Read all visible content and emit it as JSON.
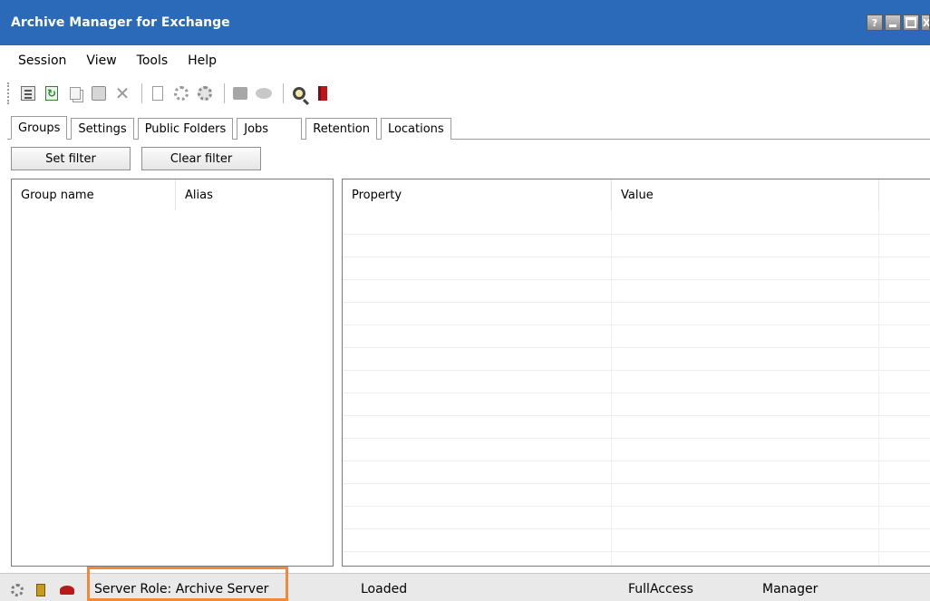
{
  "window": {
    "title": "Archive Manager for Exchange",
    "controls": {
      "help": "?",
      "close": "X"
    }
  },
  "menu": [
    "Session",
    "View",
    "Tools",
    "Help"
  ],
  "toolbar": {
    "icons": [
      "properties-icon",
      "refresh-icon",
      "copy-icon",
      "paste-icon",
      "delete-icon",
      "new-document-icon",
      "gear-icon",
      "gear-settings-icon",
      "note-icon",
      "comment-icon",
      "search-icon",
      "book-icon"
    ]
  },
  "tabs": [
    "Groups",
    "Settings",
    "Public Folders",
    "Jobs",
    "Retention",
    "Locations"
  ],
  "active_tab": "Groups",
  "filter": {
    "set_label": "Set filter",
    "clear_label": "Clear filter"
  },
  "groups_table": {
    "columns": [
      "Group name",
      "Alias"
    ],
    "rows": []
  },
  "properties_table": {
    "columns": [
      "Property",
      "Value"
    ],
    "rows": []
  },
  "status": {
    "server_role": "Server Role: Archive Server",
    "state": "Loaded",
    "access": "FullAccess",
    "role": "Manager"
  },
  "colors": {
    "titlebar": "#2a6ab8",
    "highlight_box": "#ef8a3a"
  }
}
